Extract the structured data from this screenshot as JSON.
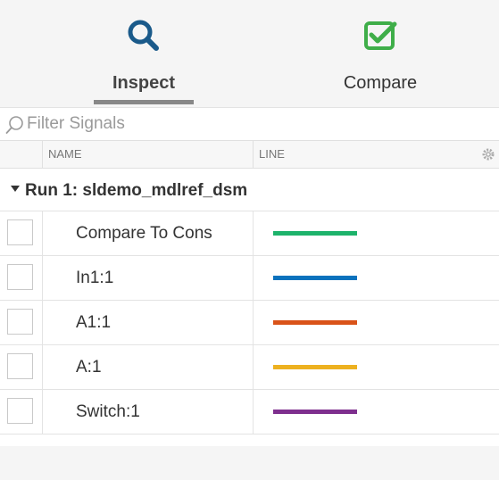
{
  "toolbar": {
    "tabs": [
      {
        "label": "Inspect",
        "icon": "magnifier-icon",
        "selected": true
      },
      {
        "label": "Compare",
        "icon": "checkbox-check-icon",
        "selected": false
      }
    ],
    "accent_colors": {
      "inspect_icon": "#1a5a8a",
      "compare_icon": "#3fae49"
    }
  },
  "filter": {
    "placeholder": "Filter Signals",
    "icon": "search-icon"
  },
  "table": {
    "columns": {
      "name": "NAME",
      "line": "LINE"
    },
    "group": {
      "label": "Run 1: sldemo_mdlref_dsm",
      "expanded": true
    },
    "rows": [
      {
        "name": "Compare To Cons",
        "color": "#1db36b",
        "checked": false
      },
      {
        "name": "In1:1",
        "color": "#0a72bd",
        "checked": false
      },
      {
        "name": "A1:1",
        "color": "#d95319",
        "checked": false
      },
      {
        "name": "A:1",
        "color": "#edb120",
        "checked": false
      },
      {
        "name": "Switch:1",
        "color": "#7e2f8e",
        "checked": false
      }
    ]
  }
}
